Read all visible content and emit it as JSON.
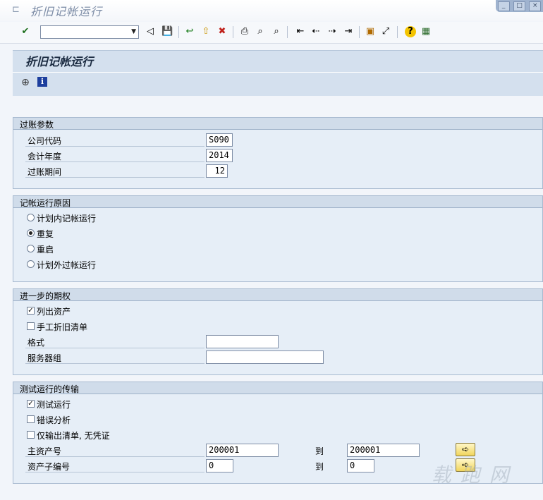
{
  "window": {
    "title": "折旧记帐运行",
    "controls": {
      "minimize": "_",
      "maximize": "□",
      "close": "×"
    }
  },
  "toolbar": {
    "command_value": "",
    "icons": {
      "enter": "✔",
      "back_arrow": "◁",
      "save": "💾",
      "back": "↩",
      "exit": "⇧",
      "cancel": "✖",
      "print": "⎙",
      "find": "⌕",
      "find_next": "⌕",
      "first": "⇤",
      "prev": "⇠",
      "next": "⇢",
      "last": "⇥",
      "new_session": "▣",
      "shortcut": "⤢",
      "help": "?",
      "layout": "▦"
    }
  },
  "header": {
    "title": "折旧记帐运行",
    "execute_icon": "⊕",
    "info_icon": "i"
  },
  "posting_params": {
    "title": "过账参数",
    "company_code": {
      "label": "公司代码",
      "value": "S090"
    },
    "fiscal_year": {
      "label": "会计年度",
      "value": "2014"
    },
    "posting_period": {
      "label": "过账期间",
      "value": "12"
    }
  },
  "run_reason": {
    "title": "记帐运行原因",
    "options": [
      "计划内记帐运行",
      "重复",
      "重启",
      "计划外过帐运行"
    ],
    "selected_index": 1
  },
  "further_options": {
    "title": "进一步的期权",
    "list_assets": {
      "label": "列出资产",
      "checked": true
    },
    "manual_depr_list": {
      "label": "手工折旧清单",
      "checked": false
    },
    "layout": {
      "label": "格式",
      "value": ""
    },
    "server_group": {
      "label": "服务器组",
      "value": ""
    }
  },
  "test_run": {
    "title": "测试运行的传输",
    "test_run": {
      "label": "测试运行",
      "checked": true
    },
    "error_analysis": {
      "label": "错误分析",
      "checked": false
    },
    "output_list_only": {
      "label": "仅输出清单, 无凭证",
      "checked": false
    },
    "main_asset": {
      "label": "主资产号",
      "from": "200001",
      "to_label": "到",
      "to": "200001"
    },
    "sub_number": {
      "label": "资产子编号",
      "from": "0",
      "to_label": "到",
      "to": "0"
    },
    "multi_select_icon": "➪"
  },
  "watermark": "载 跑 网"
}
